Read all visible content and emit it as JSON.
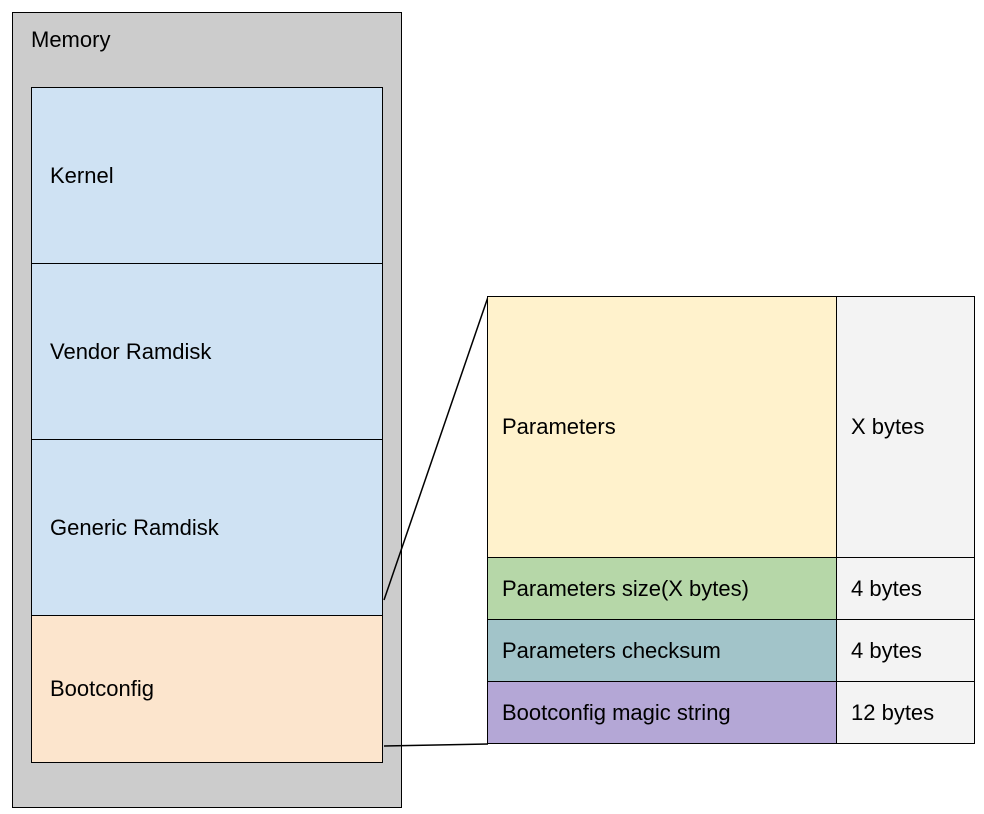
{
  "memory": {
    "title": "Memory",
    "blocks": {
      "kernel": "Kernel",
      "vendor": "Vendor Ramdisk",
      "generic": "Generic Ramdisk",
      "bootconfig": "Bootconfig"
    }
  },
  "detail": {
    "rows": [
      {
        "label": "Parameters",
        "size": "X bytes"
      },
      {
        "label": "Parameters size(X bytes)",
        "size": "4 bytes"
      },
      {
        "label": "Parameters checksum",
        "size": "4 bytes"
      },
      {
        "label": "Bootconfig magic string",
        "size": "12 bytes"
      }
    ]
  },
  "colors": {
    "memoryBg": "#cccccc",
    "blueBlock": "#cfe2f3",
    "orangeBlock": "#fce5cd",
    "paramsBg": "#fff2cc",
    "sizeBg": "#b6d7a8",
    "checksumBg": "#a2c4c9",
    "magicBg": "#b4a7d6",
    "rightBg": "#f3f3f3"
  }
}
